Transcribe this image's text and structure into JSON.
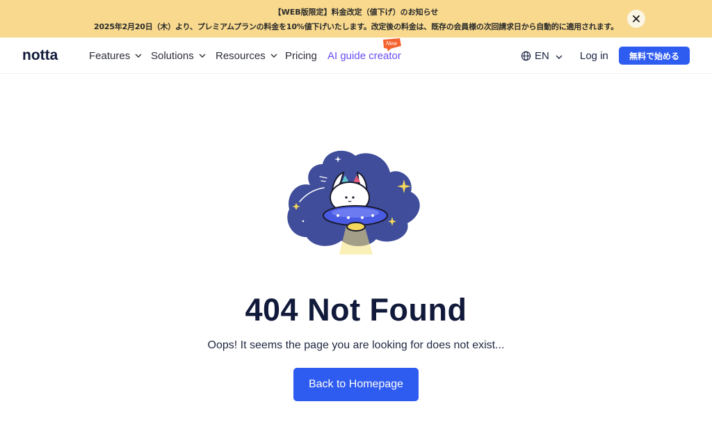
{
  "banner": {
    "title": "【WEB版限定】料金改定（値下げ）のお知らせ",
    "text": "2025年2月20日（木）より、プレミアムプランの料金を10%値下げいたします。改定後の料金は、既存の会員様の次回請求日から自動的に適用されます。",
    "close_icon": "close-icon",
    "background_color": "#f8d98e"
  },
  "nav": {
    "logo_text": "notta",
    "items": [
      {
        "label": "Features",
        "has_dropdown": true
      },
      {
        "label": "Solutions",
        "has_dropdown": true
      },
      {
        "label": "Resources",
        "has_dropdown": true
      },
      {
        "label": "Pricing",
        "has_dropdown": false
      },
      {
        "label": "AI guide creator",
        "has_dropdown": false,
        "badge": "New"
      }
    ],
    "language": {
      "label": "EN",
      "icon": "globe-icon"
    },
    "login_label": "Log in",
    "cta_label": "無料で始める",
    "accent_color": "#2f5cf0",
    "ai_color": "#6a4df5"
  },
  "main": {
    "illustration": "cat-in-ufo-illustration",
    "title": "404 Not Found",
    "subtitle": "Oops! It seems the page you are looking for does not exist...",
    "button_label": "Back to Homepage"
  }
}
